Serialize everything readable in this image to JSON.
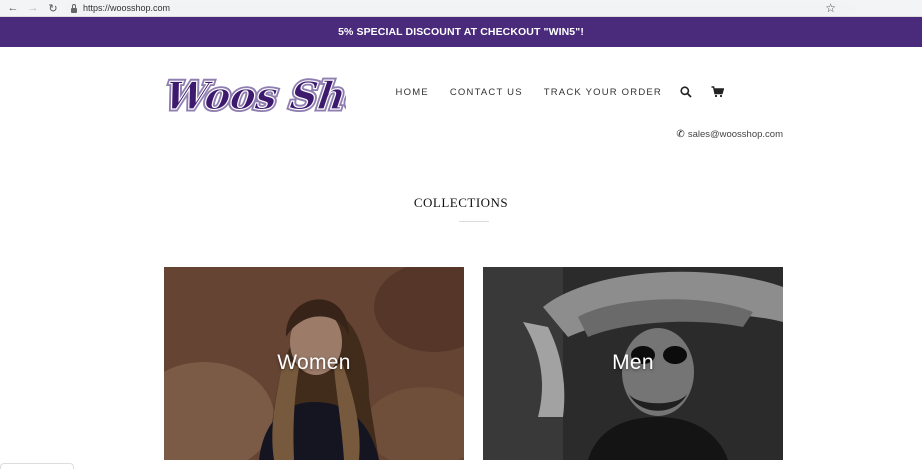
{
  "browser": {
    "url": "https://woosshop.com"
  },
  "announcement": {
    "text": "5% SPECIAL DISCOUNT AT CHECKOUT \"WIN5\"!"
  },
  "header": {
    "logo_text": "Woos Shop",
    "nav": [
      {
        "label": "HOME"
      },
      {
        "label": "CONTACT US"
      },
      {
        "label": "TRACK YOUR ORDER"
      }
    ],
    "contact_email": "sales@woosshop.com"
  },
  "collections": {
    "title": "COLLECTIONS",
    "items": [
      {
        "label": "Women"
      },
      {
        "label": "Men"
      }
    ]
  },
  "colors": {
    "announcement_bg": "#4a2a7a",
    "logo_purple": "#3d1a6e"
  },
  "icons": [
    "back-arrow-icon",
    "forward-arrow-icon",
    "reload-icon",
    "lock-icon",
    "bookmark-star-icon",
    "search-icon",
    "cart-icon",
    "phone-icon"
  ]
}
